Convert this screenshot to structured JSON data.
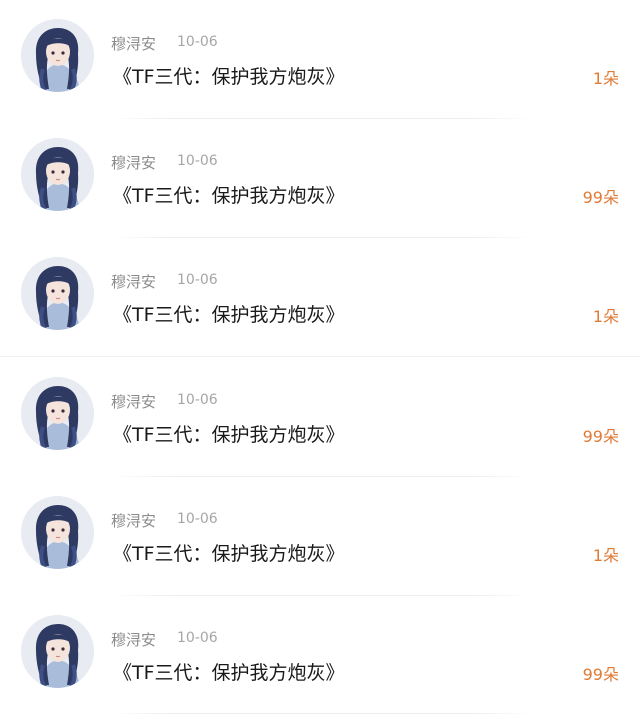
{
  "items": [
    {
      "name": "穆浔安",
      "date": "10-06",
      "title": "《TF三代：保护我方炮灰》",
      "count": "1朵"
    },
    {
      "name": "穆浔安",
      "date": "10-06",
      "title": "《TF三代：保护我方炮灰》",
      "count": "99朵"
    },
    {
      "name": "穆浔安",
      "date": "10-06",
      "title": "《TF三代：保护我方炮灰》",
      "count": "1朵"
    },
    {
      "name": "穆浔安",
      "date": "10-06",
      "title": "《TF三代：保护我方炮灰》",
      "count": "99朵"
    },
    {
      "name": "穆浔安",
      "date": "10-06",
      "title": "《TF三代：保护我方炮灰》",
      "count": "1朵"
    },
    {
      "name": "穆浔安",
      "date": "10-06",
      "title": "《TF三代：保护我方炮灰》",
      "count": "99朵"
    }
  ],
  "colors": {
    "count_accent": "#e07b36",
    "name_gray": "#8c8c8c",
    "title_text": "#1a1a1a"
  },
  "icons": {
    "avatar": "anime-girl-avatar"
  }
}
